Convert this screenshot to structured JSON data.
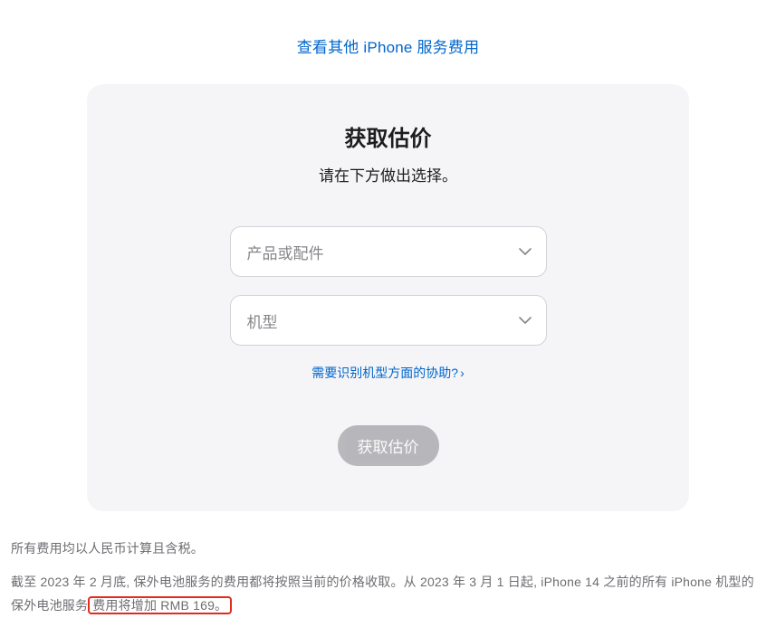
{
  "topLink": "查看其他 iPhone 服务费用",
  "card": {
    "title": "获取估价",
    "subtitle": "请在下方做出选择。",
    "select1Placeholder": "产品或配件",
    "select2Placeholder": "机型",
    "helpLink": "需要识别机型方面的协助?",
    "buttonLabel": "获取估价"
  },
  "footer": {
    "note1": "所有费用均以人民币计算且含税。",
    "note2_part1": "截至 2023 年 2 月底, 保外电池服务的费用都将按照当前的价格收取。从 2023 年 3 月 1 日起, iPhone 14 之前的所有 iPhone 机型的保外电池服务",
    "note2_highlight": "费用将增加 RMB 169。"
  }
}
